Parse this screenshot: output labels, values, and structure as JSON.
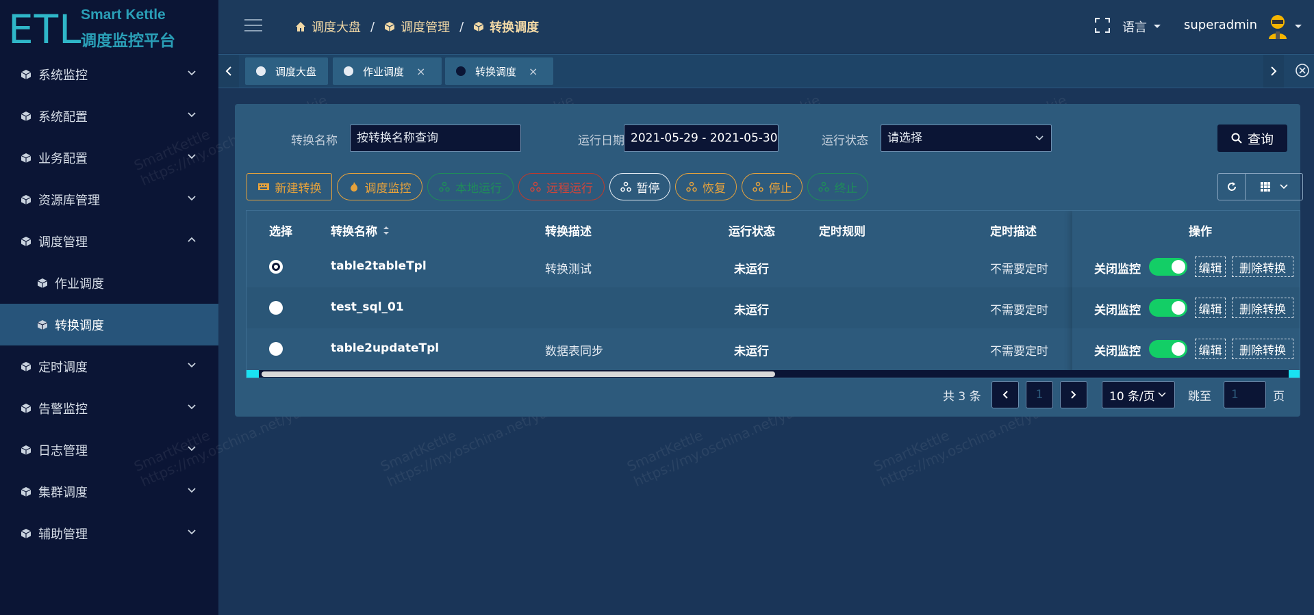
{
  "brand": {
    "mark": "ETL",
    "line1": "Smart Kettle",
    "line2": "调度监控平台"
  },
  "menu": [
    {
      "label": "系统监控",
      "expanded": false
    },
    {
      "label": "系统配置",
      "expanded": false
    },
    {
      "label": "业务配置",
      "expanded": false
    },
    {
      "label": "资源库管理",
      "expanded": false
    },
    {
      "label": "调度管理",
      "expanded": true
    },
    {
      "label": "作业调度",
      "sub": true
    },
    {
      "label": "转换调度",
      "sub": true,
      "active": true
    },
    {
      "label": "定时调度",
      "expanded": false
    },
    {
      "label": "告警监控",
      "expanded": false
    },
    {
      "label": "日志管理",
      "expanded": false
    },
    {
      "label": "集群调度",
      "expanded": false
    },
    {
      "label": "辅助管理",
      "expanded": false
    }
  ],
  "breadcrumb": {
    "home": "调度大盘",
    "sep": "/",
    "section": "调度管理",
    "current": "转换调度"
  },
  "header": {
    "language": "语言",
    "username": "superadmin"
  },
  "tabs": [
    {
      "label": "调度大盘"
    },
    {
      "label": "作业调度",
      "close": "×"
    },
    {
      "label": "转换调度",
      "close": "×",
      "active": true
    }
  ],
  "filters": {
    "name_label": "转换名称",
    "name_placeholder": "按转换名称查询",
    "date_label": "运行日期:",
    "date_value": "2021-05-29 - 2021-05-30",
    "status_label": "运行状态",
    "status_placeholder": "请选择",
    "search_label": "查询"
  },
  "actions": {
    "new": "新建转换",
    "monitor": "调度监控",
    "local_run": "本地运行",
    "remote_run": "远程运行",
    "pause": "暂停",
    "resume": "恢复",
    "stop": "停止",
    "terminate": "终止"
  },
  "table": {
    "headers": {
      "select": "选择",
      "name": "转换名称",
      "desc": "转换描述",
      "status": "运行状态",
      "rule": "定时规则",
      "rule_desc": "定时描述",
      "ops": "操作"
    },
    "rows": [
      {
        "name": "table2tableTpl",
        "desc": "转换测试",
        "status": "未运行",
        "rule": "",
        "rule_desc": "不需要定时",
        "monitor": "关闭监控",
        "edit": "编辑",
        "delete": "删除转换"
      },
      {
        "name": "test_sql_01",
        "desc": "",
        "status": "未运行",
        "rule": "",
        "rule_desc": "不需要定时",
        "monitor": "关闭监控",
        "edit": "编辑",
        "delete": "删除转换"
      },
      {
        "name": "table2updateTpl",
        "desc": "数据表同步",
        "status": "未运行",
        "rule": "",
        "rule_desc": "不需要定时",
        "monitor": "关闭监控",
        "edit": "编辑",
        "delete": "删除转换"
      }
    ]
  },
  "pagination": {
    "total": "共 3 条",
    "page": "1",
    "page_size": "10 条/页",
    "jump_label": "跳至",
    "jump_value": "1",
    "page_unit": "页"
  },
  "watermark": {
    "line1": "SmartKettle",
    "line2": "https://my.oschina.net/yaukie"
  },
  "colors": {
    "sidebar": "#0b1535",
    "active_menu": "#27547a",
    "panel": "#2d5a7c",
    "brand": "#2a9fb7",
    "toggle_on": "#13ce66"
  }
}
